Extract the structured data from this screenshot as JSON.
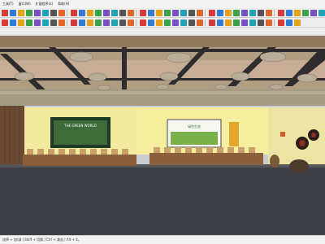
{
  "menu": {
    "items": [
      "工具(T)",
      "窗口(W)",
      "扩展程序(x)",
      "帮助(H)"
    ]
  },
  "toolbar": {
    "row1_icons": [
      "select-tool-icon",
      "eraser-icon",
      "paint-icon",
      "line-icon",
      "arc-icon",
      "rectangle-icon",
      "circle-icon",
      "polygon-icon",
      "push-pull-icon",
      "move-icon",
      "rotate-icon",
      "scale-icon",
      "follow-me-icon",
      "offset-icon",
      "tape-measure-icon",
      "dimension-icon",
      "protractor-icon",
      "text-icon",
      "axes-icon",
      "3d-text-icon",
      "orbit-icon",
      "pan-icon",
      "zoom-icon",
      "zoom-window-icon",
      "zoom-extents-icon",
      "previous-view-icon",
      "walk-icon",
      "look-around-icon",
      "position-camera-icon",
      "section-plane-icon",
      "shadow-icon",
      "fog-icon",
      "style-icon",
      "layer-icon",
      "component-icon",
      "material-icon",
      "warehouse-icon",
      "extension-icon",
      "ruby-icon",
      "settings-icon"
    ],
    "row2_icons": [
      "iso-view-icon",
      "top-view-icon",
      "front-view-icon",
      "right-view-icon",
      "back-view-icon",
      "left-view-icon",
      "xray-icon",
      "wireframe-icon",
      "hidden-line-icon",
      "shaded-icon",
      "textured-icon",
      "monochrome-icon",
      "union-icon",
      "subtract-icon",
      "trim-icon",
      "intersect-icon",
      "split-icon",
      "outer-shell-icon",
      "solid-inspector-icon",
      "sandbox-icon",
      "smoove-icon",
      "stamp-icon",
      "drape-icon",
      "add-detail-icon",
      "flip-edge-icon",
      "photo-match-icon",
      "play-icon",
      "pause-icon",
      "stop-icon",
      "record-icon",
      "render-icon",
      "camera-icon",
      "light-icon",
      "sun-icon",
      "export-icon"
    ]
  },
  "scene": {
    "left_screen_text": "THE GREEN WORLD",
    "right_screen_text": "绿色生态"
  },
  "status": {
    "text": "选择 + 加/减 | Shift + 切换 | Ctrl + 减去 | Alt + 4。"
  },
  "colors": {
    "wall": "#f3ec9f",
    "ceiling": "#a9957a",
    "floor": "#3e3f44",
    "beam": "#2e2c2c",
    "wood_panel": "#6b4a34"
  }
}
